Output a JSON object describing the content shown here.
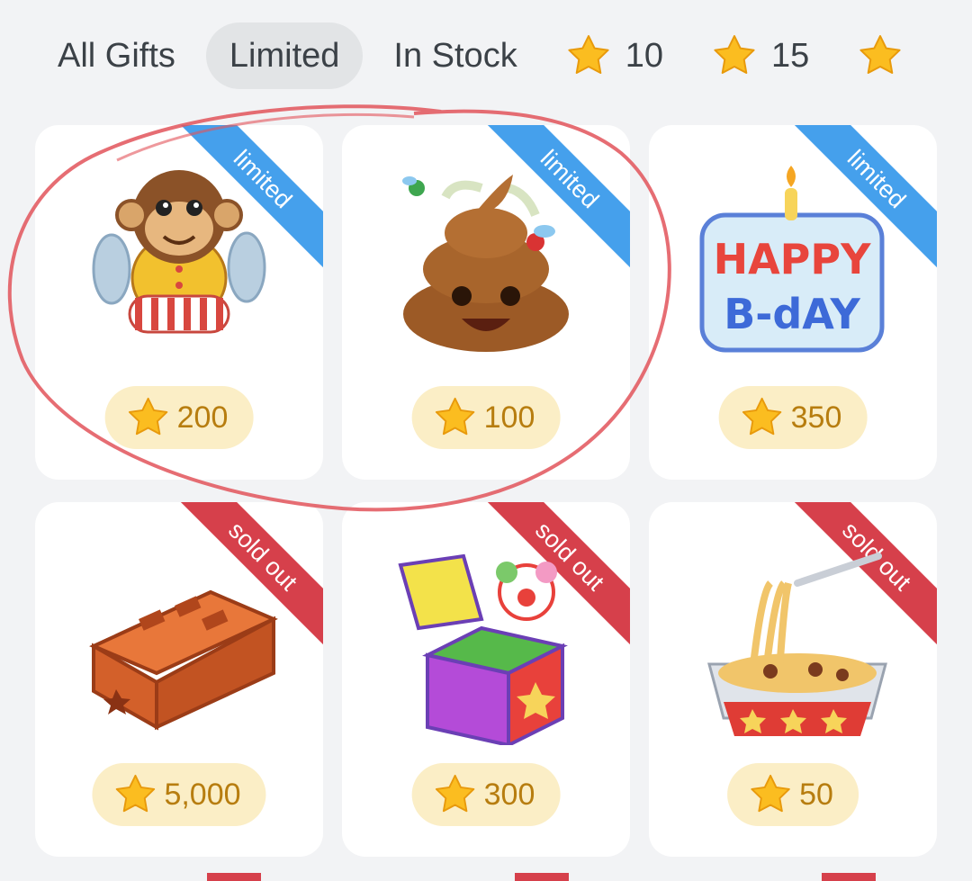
{
  "tabs": [
    {
      "label": "All Gifts",
      "active": false
    },
    {
      "label": "Limited",
      "active": true
    },
    {
      "label": "In Stock",
      "active": false
    },
    {
      "label": "10",
      "icon": "star-icon"
    },
    {
      "label": "15",
      "icon": "star-icon"
    }
  ],
  "gifts": [
    {
      "name": "monkey-cymbals",
      "badge": "limited",
      "price": "200"
    },
    {
      "name": "poop-emoji",
      "badge": "limited",
      "price": "100"
    },
    {
      "name": "happy-bday-candle",
      "badge": "limited",
      "price": "350",
      "art_text_top": "HAPPY",
      "art_text_bottom": "B-dAY"
    },
    {
      "name": "brick",
      "badge": "sold out",
      "price": "5,000"
    },
    {
      "name": "jack-in-the-box-clown",
      "badge": "sold out",
      "price": "300"
    },
    {
      "name": "noodle-dish",
      "badge": "sold out",
      "price": "50"
    }
  ],
  "colors": {
    "background": "#f2f3f5",
    "limited_ribbon": "#45a0ec",
    "soldout_ribbon": "#d6404b",
    "price_pill": "#fbeec6",
    "price_text": "#b77d0f",
    "annotation": "#e2535a"
  }
}
